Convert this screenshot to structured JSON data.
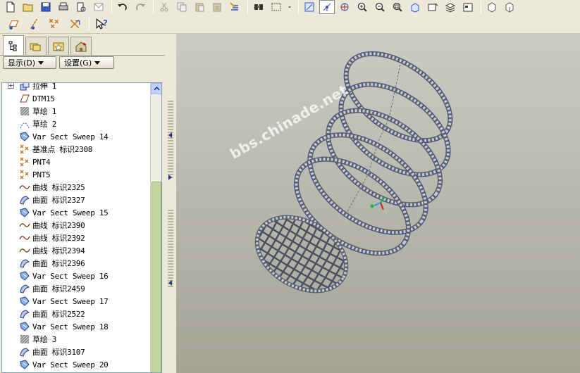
{
  "toolbar": {
    "top_icons": [
      "new-file-icon",
      "open-folder-icon",
      "save-icon",
      "print-icon",
      "print-preview-icon",
      "send-icon",
      "undo-icon",
      "redo-icon",
      "cut-icon",
      "copy-icon",
      "paste-icon",
      "paste-special-icon",
      "regenerate-icon",
      "find-icon",
      "select-box-icon",
      "dropdown-icon",
      "datum-display-icon",
      "spin-center-icon",
      "orient-icon",
      "zoom-in-icon",
      "zoom-out-icon",
      "refit-icon",
      "reorient-icon",
      "saved-views-icon",
      "layers-icon",
      "view-manager-icon",
      "window-icon",
      "window-close-icon"
    ],
    "second_icons": [
      "datum-planes-icon",
      "datum-axes-icon",
      "datum-points-icon",
      "coordinate-systems-icon",
      "context-help-icon"
    ]
  },
  "panel": {
    "tabs": [
      "model-tree-tab",
      "folder-browser-tab",
      "favorites-tab",
      "connections-tab"
    ],
    "show_button": "显示(D)",
    "settings_button": "设置(G)"
  },
  "tree": {
    "items": [
      {
        "label": "拉伸 1",
        "icon": "extrude-icon",
        "expandable": true
      },
      {
        "label": "DTM15",
        "icon": "datum-plane-icon"
      },
      {
        "label": "草绘 1",
        "icon": "sketch-icon"
      },
      {
        "label": "草绘 2",
        "icon": "sketch-curve-icon"
      },
      {
        "label": "Var Sect Sweep 14",
        "icon": "sweep-icon"
      },
      {
        "label": "基准点 标识2308",
        "icon": "datum-point-icon"
      },
      {
        "label": "PNT4",
        "icon": "datum-point-icon"
      },
      {
        "label": "PNT5",
        "icon": "datum-point-icon"
      },
      {
        "label": "曲线 标识2325",
        "icon": "curve-icon"
      },
      {
        "label": "曲面 标识2327",
        "icon": "surface-icon"
      },
      {
        "label": "Var Sect Sweep 15",
        "icon": "sweep-icon"
      },
      {
        "label": "曲线 标识2390",
        "icon": "curve-icon"
      },
      {
        "label": "曲线 标识2392",
        "icon": "curve-icon"
      },
      {
        "label": "曲线 标识2394",
        "icon": "curve-icon"
      },
      {
        "label": "曲面 标识2396",
        "icon": "surface-icon"
      },
      {
        "label": "Var Sect Sweep 16",
        "icon": "sweep-icon"
      },
      {
        "label": "曲面 标识2459",
        "icon": "surface-icon"
      },
      {
        "label": "Var Sect Sweep 17",
        "icon": "sweep-icon"
      },
      {
        "label": "曲面 标识2522",
        "icon": "surface-icon"
      },
      {
        "label": "Var Sect Sweep 18",
        "icon": "sweep-icon"
      },
      {
        "label": "草绘 3",
        "icon": "sketch-icon"
      },
      {
        "label": "曲面 标识3107",
        "icon": "surface-icon"
      },
      {
        "label": "Var Sect Sweep 20",
        "icon": "sweep-icon"
      }
    ]
  },
  "viewport": {
    "watermark": "bbs.chinade.net",
    "background_top": "#cbcbc4",
    "background_bottom": "#a4a396",
    "edge_color": "#3a40c8"
  }
}
